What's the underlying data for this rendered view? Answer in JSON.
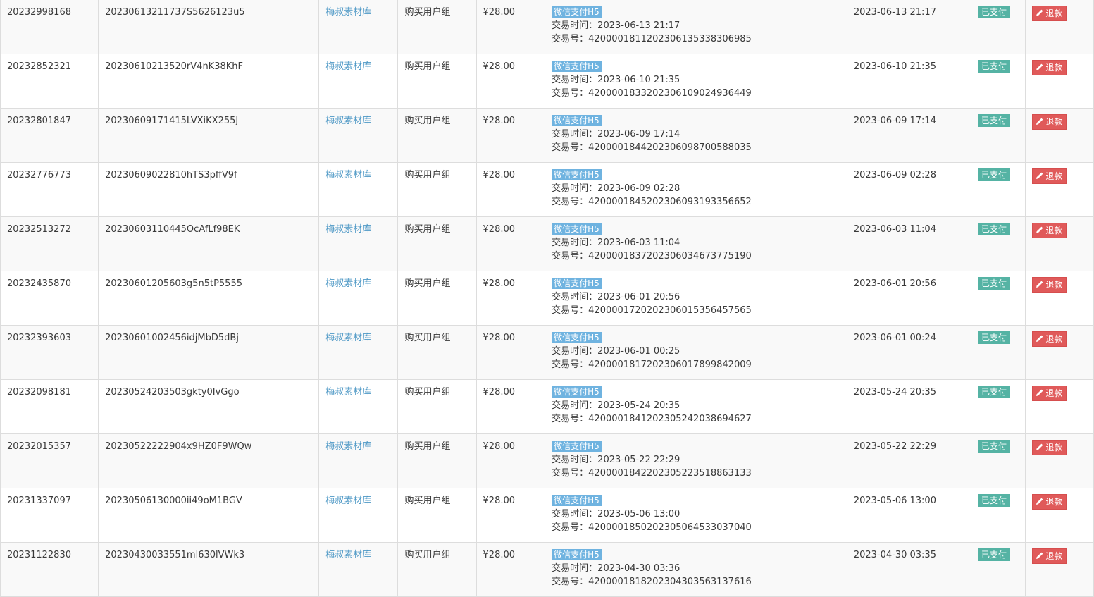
{
  "columns": {
    "payment_time_label": "交易时间：",
    "payment_no_label": "交易号：",
    "refund_label": "退款"
  },
  "rows": [
    {
      "id": "20232998168",
      "order_no": "20230613211737S5626123u5",
      "site": "梅叔素材库",
      "type": "购买用户组",
      "amount": "¥28.00",
      "pay_method": "微信支付H5",
      "pay_time": "2023-06-13 21:17",
      "trade_no": "4200001811202306135338306985",
      "date": "2023-06-13 21:17",
      "status": "已支付"
    },
    {
      "id": "20232852321",
      "order_no": "20230610213520rV4nK38KhF",
      "site": "梅叔素材库",
      "type": "购买用户组",
      "amount": "¥28.00",
      "pay_method": "微信支付H5",
      "pay_time": "2023-06-10 21:35",
      "trade_no": "4200001833202306109024936449",
      "date": "2023-06-10 21:35",
      "status": "已支付"
    },
    {
      "id": "20232801847",
      "order_no": "20230609171415LVXiKX255J",
      "site": "梅叔素材库",
      "type": "购买用户组",
      "amount": "¥28.00",
      "pay_method": "微信支付H5",
      "pay_time": "2023-06-09 17:14",
      "trade_no": "4200001844202306098700588035",
      "date": "2023-06-09 17:14",
      "status": "已支付"
    },
    {
      "id": "20232776773",
      "order_no": "20230609022810hTS3pffV9f",
      "site": "梅叔素材库",
      "type": "购买用户组",
      "amount": "¥28.00",
      "pay_method": "微信支付H5",
      "pay_time": "2023-06-09 02:28",
      "trade_no": "4200001845202306093193356652",
      "date": "2023-06-09 02:28",
      "status": "已支付"
    },
    {
      "id": "20232513272",
      "order_no": "20230603110445OcAfLf98EK",
      "site": "梅叔素材库",
      "type": "购买用户组",
      "amount": "¥28.00",
      "pay_method": "微信支付H5",
      "pay_time": "2023-06-03 11:04",
      "trade_no": "4200001837202306034673775190",
      "date": "2023-06-03 11:04",
      "status": "已支付"
    },
    {
      "id": "20232435870",
      "order_no": "20230601205603g5n5tP5555",
      "site": "梅叔素材库",
      "type": "购买用户组",
      "amount": "¥28.00",
      "pay_method": "微信支付H5",
      "pay_time": "2023-06-01 20:56",
      "trade_no": "4200001720202306015356457565",
      "date": "2023-06-01 20:56",
      "status": "已支付"
    },
    {
      "id": "20232393603",
      "order_no": "20230601002456idjMbD5dBj",
      "site": "梅叔素材库",
      "type": "购买用户组",
      "amount": "¥28.00",
      "pay_method": "微信支付H5",
      "pay_time": "2023-06-01 00:25",
      "trade_no": "4200001817202306017899842009",
      "date": "2023-06-01 00:24",
      "status": "已支付"
    },
    {
      "id": "20232098181",
      "order_no": "20230524203503gkty0IvGgo",
      "site": "梅叔素材库",
      "type": "购买用户组",
      "amount": "¥28.00",
      "pay_method": "微信支付H5",
      "pay_time": "2023-05-24 20:35",
      "trade_no": "4200001841202305242038694627",
      "date": "2023-05-24 20:35",
      "status": "已支付"
    },
    {
      "id": "20232015357",
      "order_no": "20230522222904x9HZ0F9WQw",
      "site": "梅叔素材库",
      "type": "购买用户组",
      "amount": "¥28.00",
      "pay_method": "微信支付H5",
      "pay_time": "2023-05-22 22:29",
      "trade_no": "4200001842202305223518863133",
      "date": "2023-05-22 22:29",
      "status": "已支付"
    },
    {
      "id": "20231337097",
      "order_no": "20230506130000ii49oM1BGV",
      "site": "梅叔素材库",
      "type": "购买用户组",
      "amount": "¥28.00",
      "pay_method": "微信支付H5",
      "pay_time": "2023-05-06 13:00",
      "trade_no": "4200001850202305064533037040",
      "date": "2023-05-06 13:00",
      "status": "已支付"
    },
    {
      "id": "20231122830",
      "order_no": "20230430033551ml630lVWk3",
      "site": "梅叔素材库",
      "type": "购买用户组",
      "amount": "¥28.00",
      "pay_method": "微信支付H5",
      "pay_time": "2023-04-30 03:36",
      "trade_no": "4200001818202304303563137616",
      "date": "2023-04-30 03:35",
      "status": "已支付"
    }
  ],
  "colors": {
    "link": "#4f99c6",
    "pay_badge": "#6fb3e0",
    "status_paid": "#55b3a4",
    "refund_button": "#e05a5a"
  },
  "icons": {
    "refund": "pencil-icon"
  }
}
